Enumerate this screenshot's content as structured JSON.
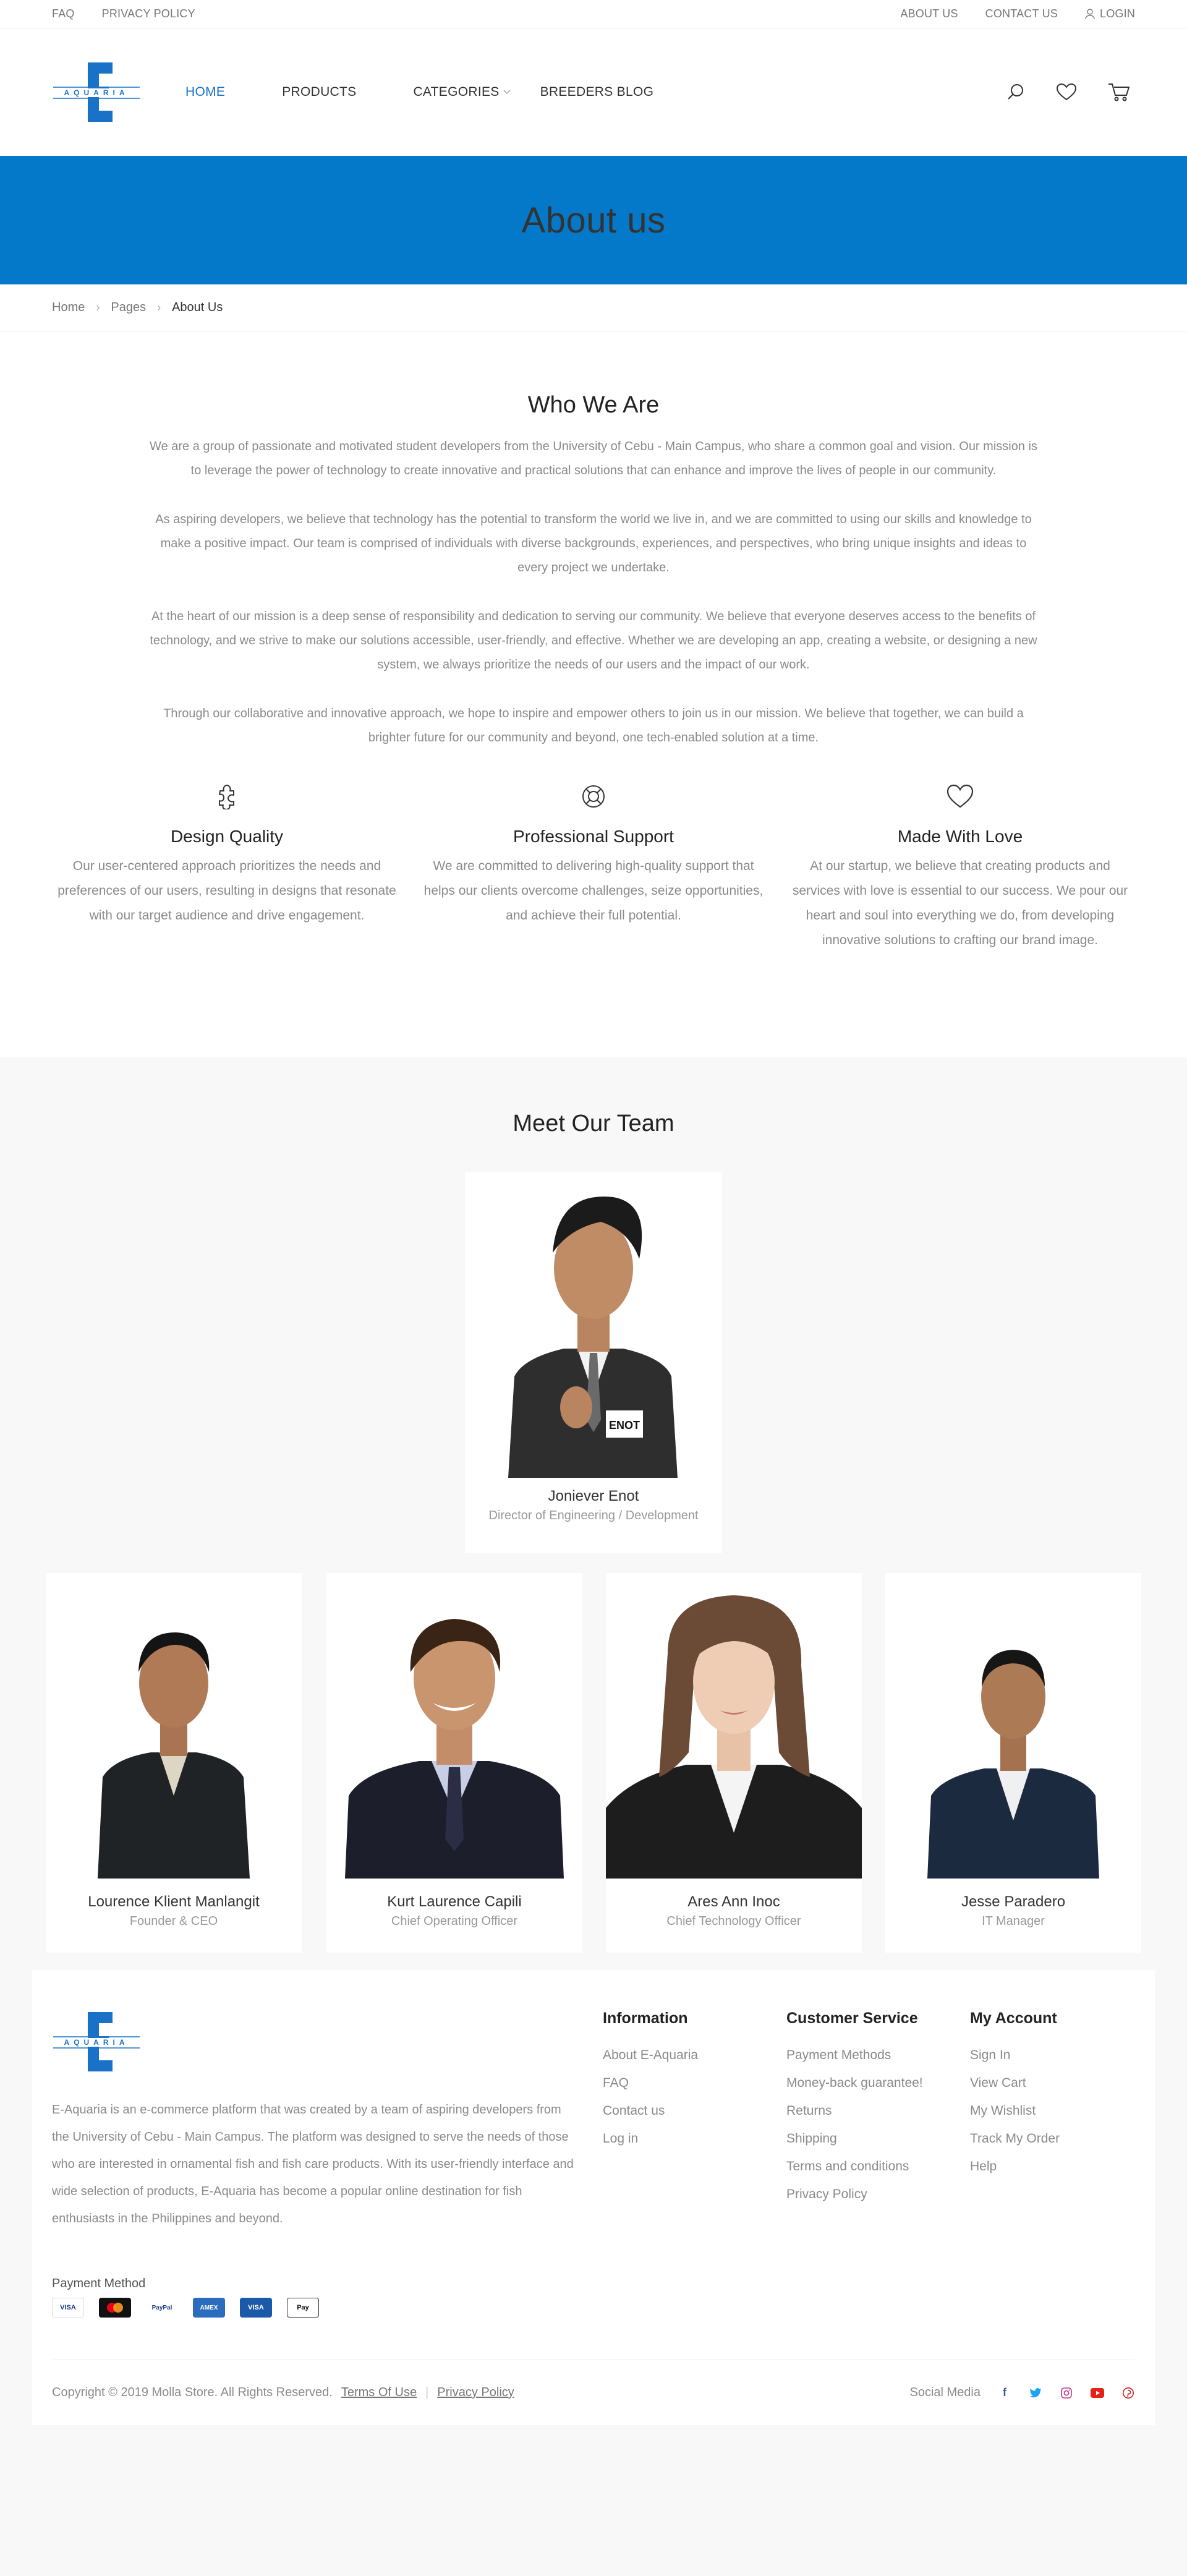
{
  "topbar": {
    "faq": "FAQ",
    "privacy": "PRIVACY POLICY",
    "about": "ABOUT US",
    "contact": "CONTACT US",
    "login": "LOGIN"
  },
  "brand": {
    "logo_text": "AQUARIA",
    "color": "#1a72c8"
  },
  "nav": {
    "home": "HOME",
    "products": "PRODUCTS",
    "categories": "CATEGORIES",
    "blog": "BREEDERS BLOG"
  },
  "banner": {
    "title": "About us",
    "color": "#0479c9"
  },
  "breadcrumb": {
    "home": "Home",
    "pages": "Pages",
    "current": "About Us"
  },
  "who": {
    "title": "Who We Are",
    "p1": "We are a group of passionate and motivated student developers from the University of Cebu - Main Campus, who share a common goal and vision. Our mission is to leverage the power of technology to create innovative and practical solutions that can enhance and improve the lives of people in our community.",
    "p2": "As aspiring developers, we believe that technology has the potential to transform the world we live in, and we are committed to using our skills and knowledge to make a positive impact. Our team is comprised of individuals with diverse backgrounds, experiences, and perspectives, who bring unique insights and ideas to every project we undertake.",
    "p3": "At the heart of our mission is a deep sense of responsibility and dedication to serving our community. We believe that everyone deserves access to the benefits of technology, and we strive to make our solutions accessible, user-friendly, and effective. Whether we are developing an app, creating a website, or designing a new system, we always prioritize the needs of our users and the impact of our work.",
    "p4": "Through our collaborative and innovative approach, we hope to inspire and empower others to join us in our mission. We believe that together, we can build a brighter future for our community and beyond, one tech-enabled solution at a time."
  },
  "features": [
    {
      "title": "Design Quality",
      "text": "Our user-centered approach prioritizes the needs and preferences of our users, resulting in designs that resonate with our target audience and drive engagement.",
      "icon": "puzzle-icon"
    },
    {
      "title": "Professional Support",
      "text": "We are committed to delivering high-quality support that helps our clients overcome challenges, seize opportunities, and achieve their full potential.",
      "icon": "lifebuoy-icon"
    },
    {
      "title": "Made With Love",
      "text": "At our startup, we believe that creating products and services with love is essential to our success. We pour our heart and soul into everything we do, from developing innovative solutions to crafting our brand image.",
      "icon": "heart-icon"
    }
  ],
  "team": {
    "title": "Meet Our Team",
    "lead": {
      "name": "Joniever Enot",
      "role": "Director of Engineering / Development",
      "badge": "ENOT"
    },
    "members": [
      {
        "name": "Lourence Klient Manlangit",
        "role": "Founder & CEO"
      },
      {
        "name": "Kurt Laurence Capili",
        "role": "Chief Operating Officer"
      },
      {
        "name": "Ares Ann Inoc",
        "role": "Chief Technology Officer"
      },
      {
        "name": "Jesse Paradero",
        "role": "IT Manager"
      }
    ]
  },
  "footer": {
    "about": "E-Aquaria is an e-commerce platform that was created by a team of aspiring developers from the University of Cebu - Main Campus. The platform was designed to serve the needs of those who are interested in ornamental fish and fish care products. With its user-friendly interface and wide selection of products, E-Aquaria has become a popular online destination for fish enthusiasts in the Philippines and beyond.",
    "payment_title": "Payment Method",
    "payment_cards": [
      "VISA",
      "MC",
      "PayPal",
      "AMEX",
      "VISA",
      "Pay"
    ],
    "info": {
      "title": "Information",
      "links": [
        "About E-Aquaria",
        "FAQ",
        "Contact us",
        "Log in"
      ]
    },
    "service": {
      "title": "Customer Service",
      "links": [
        "Payment Methods",
        "Money-back guarantee!",
        "Returns",
        "Shipping",
        "Terms and conditions",
        "Privacy Policy"
      ]
    },
    "account": {
      "title": "My Account",
      "links": [
        "Sign In",
        "View Cart",
        "My Wishlist",
        "Track My Order",
        "Help"
      ]
    },
    "copyright": "Copyright © 2019 Molla Store. All Rights Reserved.",
    "terms": "Terms Of Use",
    "privacy": "Privacy Policy",
    "social_label": "Social Media"
  }
}
